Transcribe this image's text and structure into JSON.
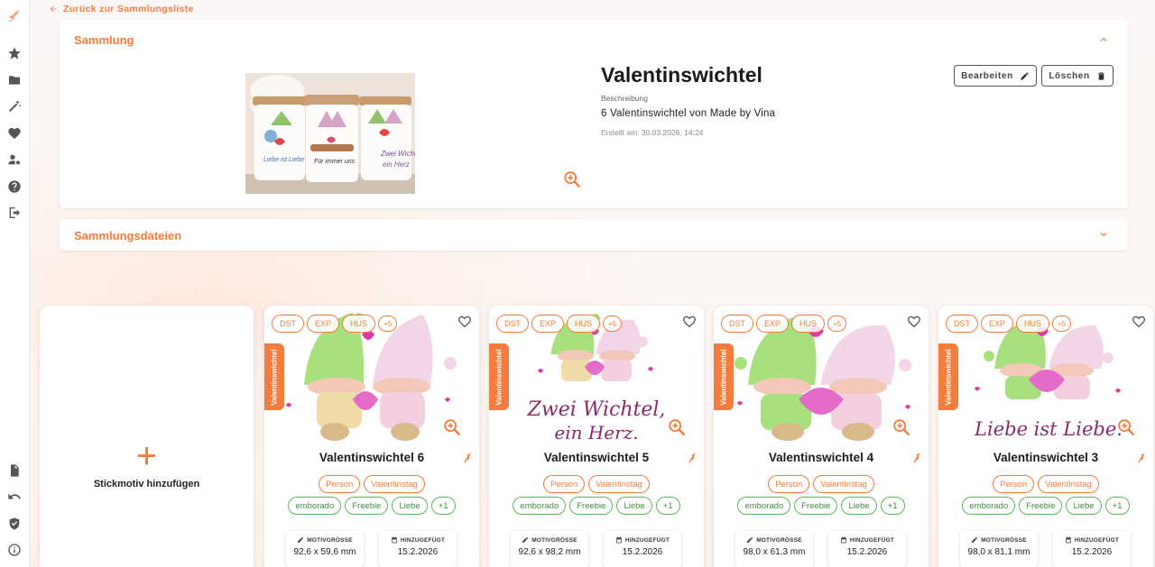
{
  "back_link": "Zurück zur Sammlungsliste",
  "collection": {
    "panel_title": "Sammlung",
    "name": "Valentinswichtel",
    "description_label": "Beschreibung",
    "description": "6 Valentinswichtel von Made by Vina",
    "created": "Erstellt am: 30.03.2026, 14:24",
    "edit_label": "Bearbeiten",
    "delete_label": "Löschen"
  },
  "files_panel": {
    "title": "Sammlungsdateien"
  },
  "add_card": {
    "plus": "+",
    "label": "Stickmotiv hinzufügen"
  },
  "labels": {
    "motif_size": "MOTIVGRÖSSE",
    "added": "HINZUGEFÜGT"
  },
  "cards": [
    {
      "title": "Valentinswichtel 6",
      "ribbon": "Valentinswichtel",
      "formats": [
        "DST",
        "EXP",
        "HUS",
        "+5"
      ],
      "tags_row1": [
        "Person",
        "Valentinstag"
      ],
      "tags_row2": [
        "emborado",
        "Freebie",
        "Liebe",
        "+1"
      ],
      "size": "92,6 x 59,6 mm",
      "added": "15.2.2026"
    },
    {
      "title": "Valentinswichtel 5",
      "ribbon": "Valentinswichtel",
      "formats": [
        "DST",
        "EXP",
        "HUS",
        "+5"
      ],
      "tags_row1": [
        "Person",
        "Valentinstag"
      ],
      "tags_row2": [
        "emborado",
        "Freebie",
        "Liebe",
        "+1"
      ],
      "size": "92,6 x 98,2 mm",
      "added": "15.2.2026",
      "script_text_1": "Zwei Wichtel,",
      "script_text_2": "ein Herz."
    },
    {
      "title": "Valentinswichtel 4",
      "ribbon": "Valentinswichtel",
      "formats": [
        "DST",
        "EXP",
        "HUS",
        "+5"
      ],
      "tags_row1": [
        "Person",
        "Valentinstag"
      ],
      "tags_row2": [
        "emborado",
        "Freebie",
        "Liebe",
        "+1"
      ],
      "size": "98,0 x 61,3 mm",
      "added": "15.2.2026"
    },
    {
      "title": "Valentinswichtel 3",
      "ribbon": "Valentinswichtel",
      "formats": [
        "DST",
        "EXP",
        "HUS",
        "+5"
      ],
      "tags_row1": [
        "Person",
        "Valentinstag"
      ],
      "tags_row2": [
        "emborado",
        "Freebie",
        "Liebe",
        "+1"
      ],
      "size": "98,0 x 81,1 mm",
      "added": "15.2.2026",
      "script_text_1": "Liebe ist Liebe."
    }
  ],
  "colors": {
    "accent": "#f47c3c",
    "tag_green": "#5cb85c"
  }
}
